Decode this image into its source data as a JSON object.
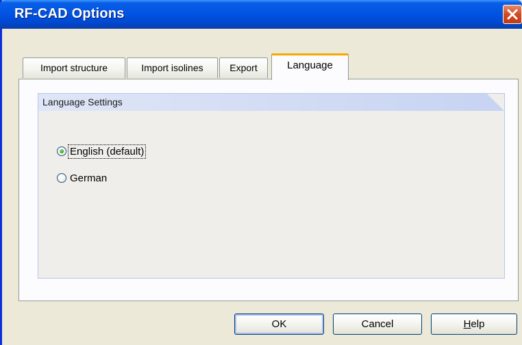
{
  "window": {
    "title": "RF-CAD Options"
  },
  "tabs": [
    {
      "label": "Import structure"
    },
    {
      "label": "Import isolines"
    },
    {
      "label": "Export"
    },
    {
      "label": "Language"
    }
  ],
  "language_settings": {
    "group_title": "Language Settings",
    "options": [
      {
        "label": "English (default)",
        "selected": true
      },
      {
        "label": "German",
        "selected": false
      }
    ]
  },
  "buttons": {
    "ok": "OK",
    "cancel": "Cancel",
    "help_mnemonic": "H",
    "help_rest": "elp"
  },
  "colors": {
    "titlebar": "#0054e3",
    "active_tab_accent": "#f6a800",
    "close_button": "#d24a22"
  }
}
